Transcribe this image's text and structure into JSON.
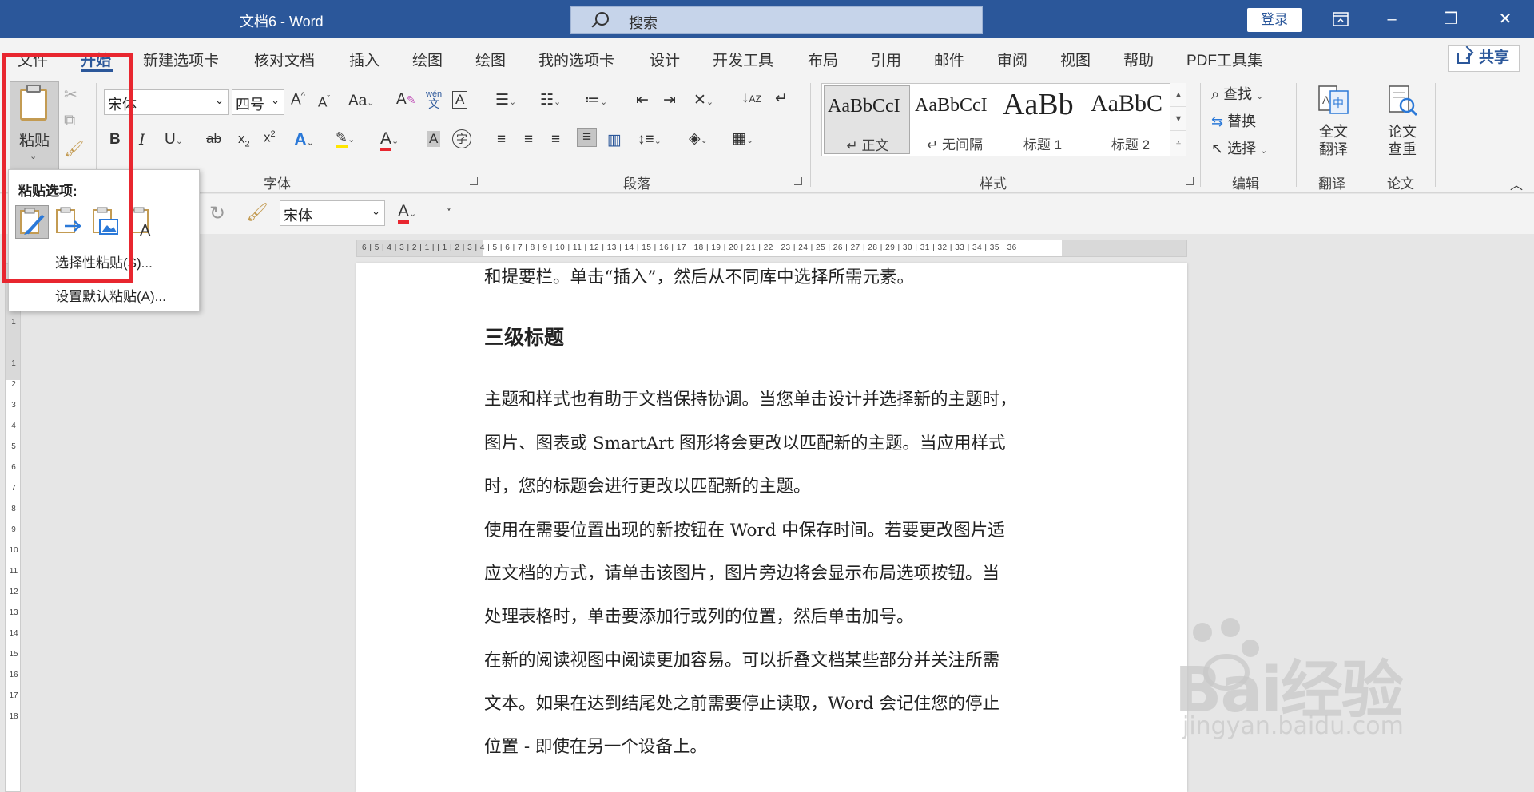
{
  "titlebar": {
    "title": "文档6  -  Word",
    "search_label": "搜索",
    "login_label": "登录"
  },
  "tabs": [
    {
      "key": "file",
      "label": "文件"
    },
    {
      "key": "home",
      "label": "开始"
    },
    {
      "key": "newtab",
      "label": "新建选项卡"
    },
    {
      "key": "review_doc",
      "label": "核对文档"
    },
    {
      "key": "insert",
      "label": "插入"
    },
    {
      "key": "draw1",
      "label": "绘图"
    },
    {
      "key": "draw2",
      "label": "绘图"
    },
    {
      "key": "mytab",
      "label": "我的选项卡"
    },
    {
      "key": "design",
      "label": "设计"
    },
    {
      "key": "developer",
      "label": "开发工具"
    },
    {
      "key": "layout",
      "label": "布局"
    },
    {
      "key": "references",
      "label": "引用"
    },
    {
      "key": "mailings",
      "label": "邮件"
    },
    {
      "key": "review",
      "label": "审阅"
    },
    {
      "key": "view",
      "label": "视图"
    },
    {
      "key": "help",
      "label": "帮助"
    },
    {
      "key": "pdf",
      "label": "PDF工具集"
    }
  ],
  "share_label": "共享",
  "ribbon": {
    "paste_label": "粘贴",
    "font_name": "宋体",
    "font_size": "四号",
    "groups": {
      "font": "字体",
      "paragraph": "段落",
      "styles": "样式",
      "editing": "编辑",
      "translate": "翻译",
      "thesis": "论文"
    },
    "styles": [
      {
        "preview": "AaBbCcI",
        "name": "↵ 正文"
      },
      {
        "preview": "AaBbCcI",
        "name": "↵ 无间隔"
      },
      {
        "preview": "AaBb",
        "name": "标题 1"
      },
      {
        "preview": "AaBbC",
        "name": "标题 2"
      }
    ],
    "find_label": "查找",
    "replace_label": "替换",
    "select_label": "选择",
    "full_translate": [
      "全文",
      "翻译"
    ],
    "thesis_check": [
      "论文",
      "查重"
    ],
    "font_color": "#e8262f",
    "highlight_color": "#ffe600"
  },
  "qat": {
    "font_name": "宋体"
  },
  "paste_menu": {
    "title": "粘贴选项:",
    "special": "选择性粘贴(S)...",
    "set_default": "设置默认粘贴(A)..."
  },
  "ruler_h": "6 | 5 | 4 | 3 | 2 | 1 |   | 1 | 2 | 3 | 4 | 5 | 6 | 7 | 8 | 9 | 10 | 11 | 12 | 13 | 14 | 15 | 16 | 17 | 18 | 19 | 20 | 21 | 22 | 23 | 24 | 25 | 26 | 27 | 28 | 29 | 30 | 31 | 32 | 33 | 34 | 35 | 36",
  "ruler_v": [
    "3",
    "2",
    "1",
    "",
    "1",
    "2",
    "3",
    "4",
    "5",
    "6",
    "7",
    "8",
    "9",
    "10",
    "11",
    "12",
    "13",
    "14",
    "15",
    "16",
    "17",
    "18"
  ],
  "document": {
    "lines": [
      "和提要栏。单击“插入”，然后从不同库中选择所需元素。"
    ],
    "heading": "三级标题",
    "body": [
      "主题和样式也有助于文档保持协调。当您单击设计并选择新的主题时，",
      "图片、图表或 SmartArt 图形将会更改以匹配新的主题。当应用样式",
      "时，您的标题会进行更改以匹配新的主题。",
      "使用在需要位置出现的新按钮在 Word 中保存时间。若要更改图片适",
      "应文档的方式，请单击该图片，图片旁边将会显示布局选项按钮。当",
      "处理表格时，单击要添加行或列的位置，然后单击加号。",
      "在新的阅读视图中阅读更加容易。可以折叠文档某些部分并关注所需",
      "文本。如果在达到结尾处之前需要停止读取，Word  会记住您的停止",
      "位置 - 即使在另一个设备上。"
    ]
  },
  "watermark": {
    "brand": "Bai经验",
    "site": "jingyan.baidu.com"
  }
}
